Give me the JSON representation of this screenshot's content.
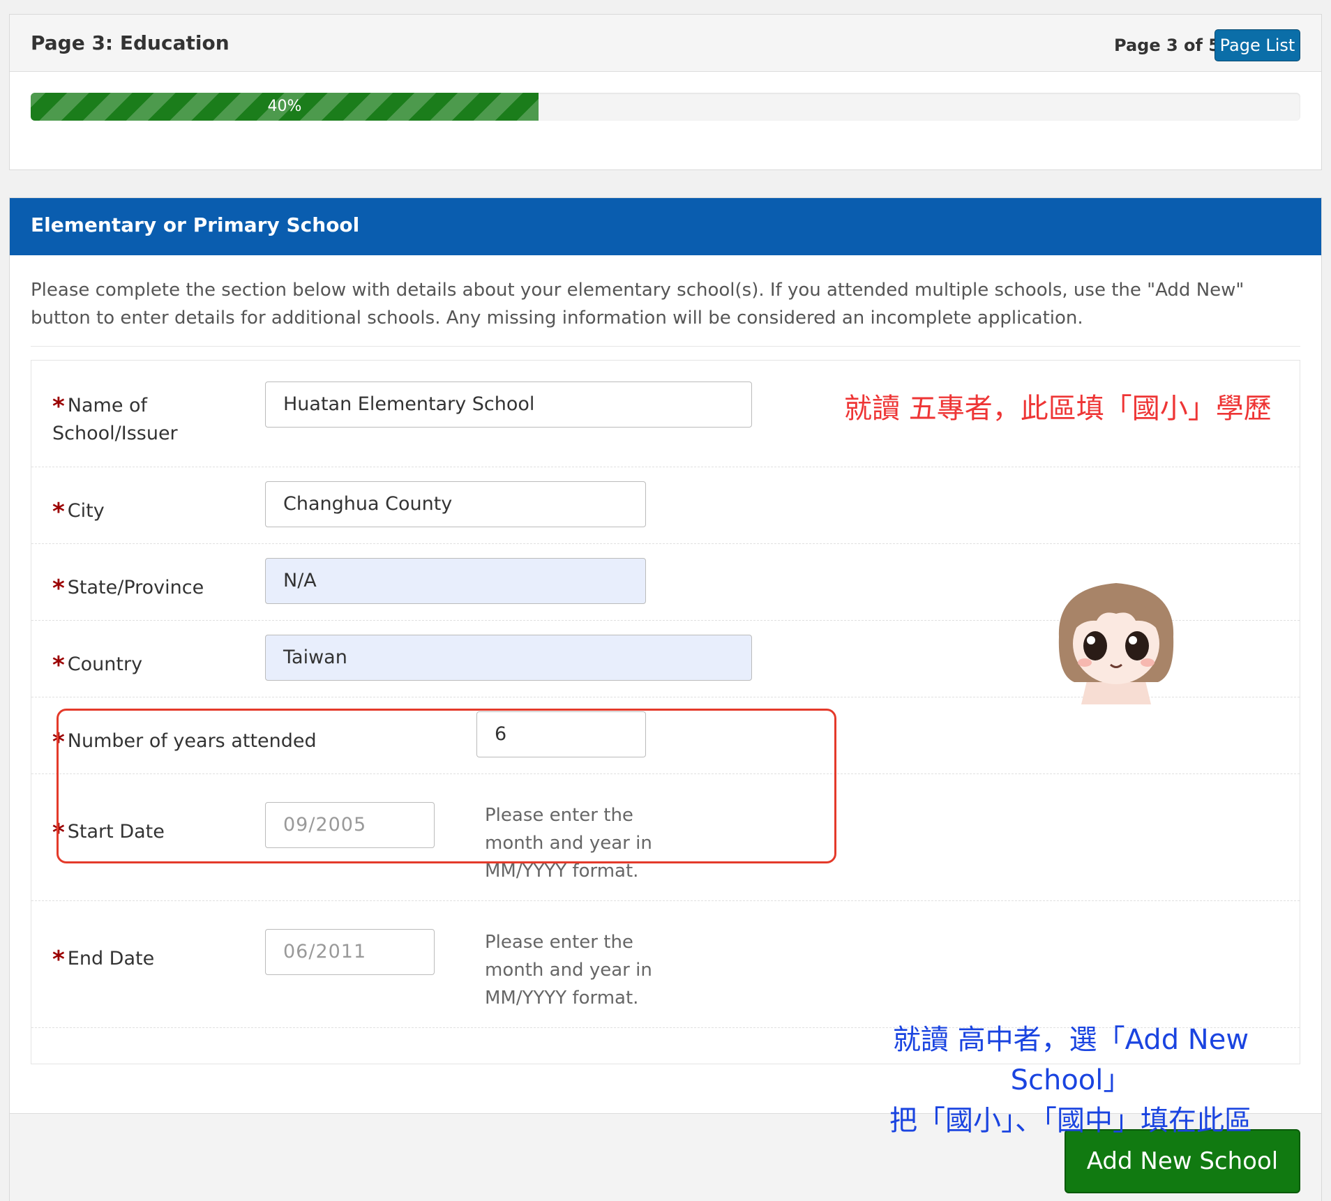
{
  "header": {
    "page_title": "Page 3: Education",
    "page_count": "Page 3 of 5",
    "page_list_label": "Page List"
  },
  "progress": {
    "value": 0.4,
    "label": "40%",
    "color": "#1b7d1b"
  },
  "section": {
    "title": "Elementary or Primary School",
    "intro": "Please complete the section below with details about your elementary school(s). If you attended multiple schools, use the \"Add New\" button to enter details for additional schools. Any missing information will be considered an incomplete application.",
    "required_marker": "*"
  },
  "fields": {
    "school_name": {
      "label_line1": "Name of",
      "label_line2": "School/Issuer",
      "value": "Huatan Elementary School"
    },
    "city": {
      "label": "City",
      "value": "Changhua County"
    },
    "state": {
      "label": "State/Province",
      "value": "N/A"
    },
    "country": {
      "label": "Country",
      "value": "Taiwan"
    },
    "years": {
      "label": "Number of years attended",
      "value": "6"
    },
    "start_date": {
      "label": "Start Date",
      "value": "09/2005",
      "hint_line1": "Please enter the",
      "hint_line2": "month and year in",
      "hint_line3": "MM/YYYY format."
    },
    "end_date": {
      "label": "End Date",
      "value": "06/2011",
      "hint_line1": "Please enter the",
      "hint_line2": "month and year in",
      "hint_line3": "MM/YYYY format."
    }
  },
  "annotations": {
    "red_note": "就讀 五專者，此區填「國小」學歷",
    "blue_note_line1": "就讀 高中者，選「Add New School」",
    "blue_note_line2": "把「國小」、「國中」填在此區",
    "highlight_color": "#e43a2a"
  },
  "footer": {
    "add_button_label": "Add New School"
  },
  "colors": {
    "header_blue": "#0a5daf",
    "button_green": "#117a11",
    "page_list_blue": "#0b6ea8",
    "required_red": "#9b0000"
  }
}
